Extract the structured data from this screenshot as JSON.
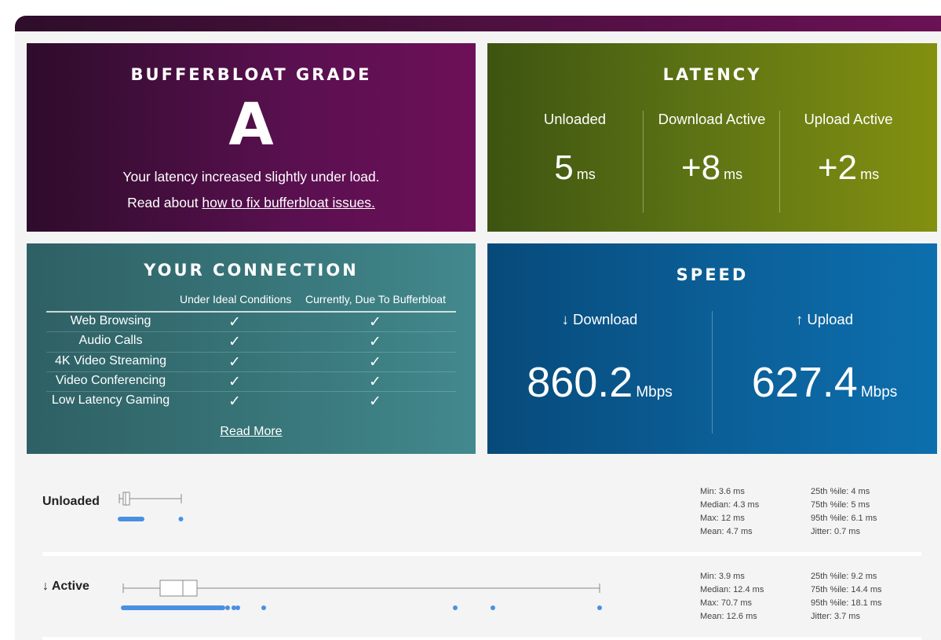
{
  "grade": {
    "title": "BUFFERBLOAT GRADE",
    "letter": "A",
    "message": "Your latency increased slightly under load.",
    "link_prefix": "Read about ",
    "link_text": "how to fix bufferbloat issues."
  },
  "latency": {
    "title": "LATENCY",
    "unit": "ms",
    "columns": [
      {
        "label": "Unloaded",
        "value": "5"
      },
      {
        "label": "Download Active",
        "value": "+8"
      },
      {
        "label": "Upload Active",
        "value": "+2"
      }
    ]
  },
  "connection": {
    "title": "YOUR CONNECTION",
    "col_ideal": "Under Ideal Conditions",
    "col_current": "Currently, Due To Bufferbloat",
    "check": "✓",
    "rows": [
      {
        "name": "Web Browsing"
      },
      {
        "name": "Audio Calls"
      },
      {
        "name": "4K Video Streaming"
      },
      {
        "name": "Video Conferencing"
      },
      {
        "name": "Low Latency Gaming"
      }
    ],
    "read_more": "Read More"
  },
  "speed": {
    "title": "SPEED",
    "unit": "Mbps",
    "download": {
      "label": "↓ Download",
      "value": "860.2"
    },
    "upload": {
      "label": "↑ Upload",
      "value": "627.4"
    }
  },
  "plots": [
    {
      "label": "Unloaded",
      "box": {
        "min": 3.6,
        "q1": 4,
        "median": 4.3,
        "q3": 5,
        "max": 12
      },
      "stats_left": [
        "Min: 3.6 ms",
        "Median: 4.3 ms",
        "Max: 12 ms",
        "Mean: 4.7 ms"
      ],
      "stats_right": [
        "25th %ile: 4 ms",
        "75th %ile: 5 ms",
        "95th %ile: 6.1 ms",
        "Jitter: 0.7 ms"
      ]
    },
    {
      "label": "↓ Active",
      "box": {
        "min": 3.9,
        "q1": 9.2,
        "median": 12.4,
        "q3": 14.4,
        "max": 70.7
      },
      "stats_left": [
        "Min: 3.9 ms",
        "Median: 12.4 ms",
        "Max: 70.7 ms",
        "Mean: 12.6 ms"
      ],
      "stats_right": [
        "25th %ile: 9.2 ms",
        "75th %ile: 14.4 ms",
        "95th %ile: 18.1 ms",
        "Jitter: 3.7 ms"
      ]
    }
  ],
  "colors": {
    "dots": "#4a90e2",
    "box_stroke": "#888888"
  }
}
